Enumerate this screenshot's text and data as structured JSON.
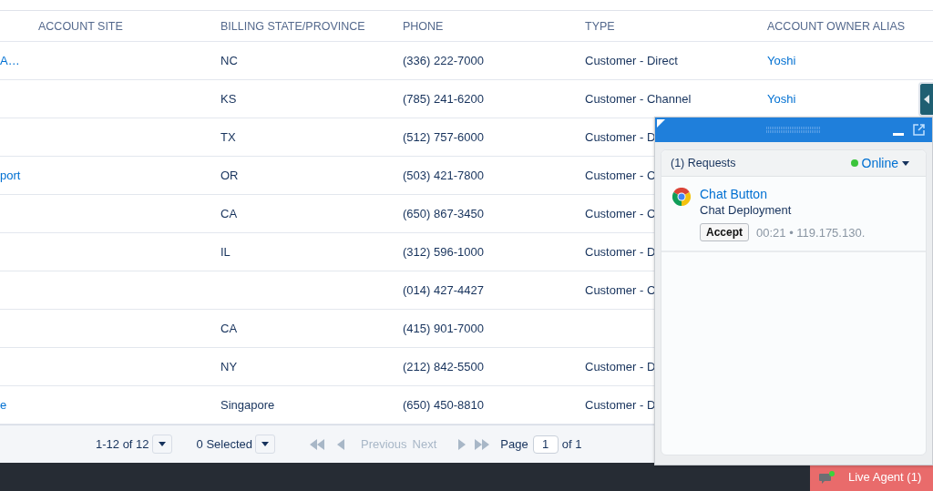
{
  "table": {
    "columns": [
      "ACCOUNT SITE",
      "BILLING STATE/PROVINCE",
      "PHONE",
      "TYPE",
      "ACCOUNT OWNER ALIAS"
    ],
    "rows": [
      {
        "column_1": "A…",
        "state": "NC",
        "phone": "(336) 222-7000",
        "type": "Customer - Direct",
        "owner": "Yoshi"
      },
      {
        "state": "KS",
        "phone": "(785) 241-6200",
        "type": "Customer - Channel",
        "owner": "Yoshi"
      },
      {
        "state": "TX",
        "phone": "(512) 757-6000",
        "type": "Customer - D"
      },
      {
        "column_1": "port",
        "state": "OR",
        "phone": "(503) 421-7800",
        "type": "Customer - C"
      },
      {
        "state": "CA",
        "phone": "(650) 867-3450",
        "type": "Customer - C"
      },
      {
        "state": "IL",
        "phone": "(312) 596-1000",
        "type": "Customer - D"
      },
      {
        "phone": "(014) 427-4427",
        "type": "Customer - C"
      },
      {
        "state": "CA",
        "phone": "(415) 901-7000"
      },
      {
        "state": "NY",
        "phone": "(212) 842-5500",
        "type": "Customer - D"
      },
      {
        "column_1": "e",
        "state": "Singapore",
        "phone": "(650) 450-8810",
        "type": "Customer - D"
      }
    ]
  },
  "footer": {
    "range": "1-12 of 12",
    "selected": "0 Selected",
    "previous": {
      "label": "Previous",
      "disabled": true
    },
    "next": {
      "label": "Next",
      "disabled": true
    },
    "page_label": "Page",
    "page_value": "1",
    "page_total": "of 1"
  },
  "chat": {
    "requests": "(1) Requests",
    "status": {
      "label": "Online",
      "on": true
    },
    "items": [
      {
        "title": "Chat Button",
        "subtitle": "Chat Deployment",
        "action": "Accept",
        "meta": "00:21 • 119.175.130."
      }
    ]
  },
  "bottom_bar": {
    "live_agent": "Live Agent (1)"
  }
}
